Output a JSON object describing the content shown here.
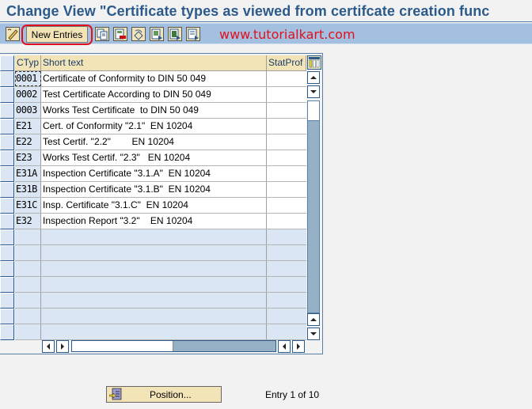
{
  "title": "Change View \"Certificate types as viewed from certifcate creation func",
  "toolbar": {
    "buttons": [
      {
        "name": "display-change-icon"
      },
      {
        "name": "new-entries",
        "label": "New Entries"
      },
      {
        "name": "copy-as-icon"
      },
      {
        "name": "delete-icon"
      },
      {
        "name": "undo-change-icon"
      },
      {
        "name": "select-all-icon"
      },
      {
        "name": "select-block-icon"
      },
      {
        "name": "deselect-all-icon"
      }
    ],
    "watermark": "www.tutorialkart.com"
  },
  "table": {
    "columns": [
      "CTyp",
      "Short text",
      "StatProf"
    ],
    "rows": [
      {
        "ctyp": "0001",
        "short_text": "Certificate of Conformity to DIN 50 049",
        "statprof": ""
      },
      {
        "ctyp": "0002",
        "short_text": "Test Certificate According to DIN 50 049",
        "statprof": ""
      },
      {
        "ctyp": "0003",
        "short_text": "Works Test Certificate  to DIN 50 049",
        "statprof": ""
      },
      {
        "ctyp": "E21",
        "short_text": "Cert. of Conformity \"2.1\"  EN 10204",
        "statprof": ""
      },
      {
        "ctyp": "E22",
        "short_text": "Test Certif. \"2.2\"        EN 10204",
        "statprof": ""
      },
      {
        "ctyp": "E23",
        "short_text": "Works Test Certif. \"2.3\"   EN 10204",
        "statprof": ""
      },
      {
        "ctyp": "E31A",
        "short_text": "Inspection Certificate \"3.1.A\"  EN 10204",
        "statprof": ""
      },
      {
        "ctyp": "E31B",
        "short_text": "Inspection Certificate \"3.1.B\"  EN 10204",
        "statprof": ""
      },
      {
        "ctyp": "E31C",
        "short_text": "Insp. Certificate \"3.1.C\"  EN 10204",
        "statprof": ""
      },
      {
        "ctyp": "E32",
        "short_text": "Inspection Report \"3.2\"    EN 10204",
        "statprof": ""
      }
    ],
    "empty_rows": 7,
    "vertical_scroll_position": 0
  },
  "footer": {
    "position_button": "Position...",
    "entry_text": "Entry 1 of 10"
  },
  "colors": {
    "title": "#2c5a8a",
    "toolbar_bg": "#a3c0e0",
    "button_bg": "#f3e4b8",
    "highlight": "#e0101e",
    "key_col_bg": "#dbe6f4"
  }
}
